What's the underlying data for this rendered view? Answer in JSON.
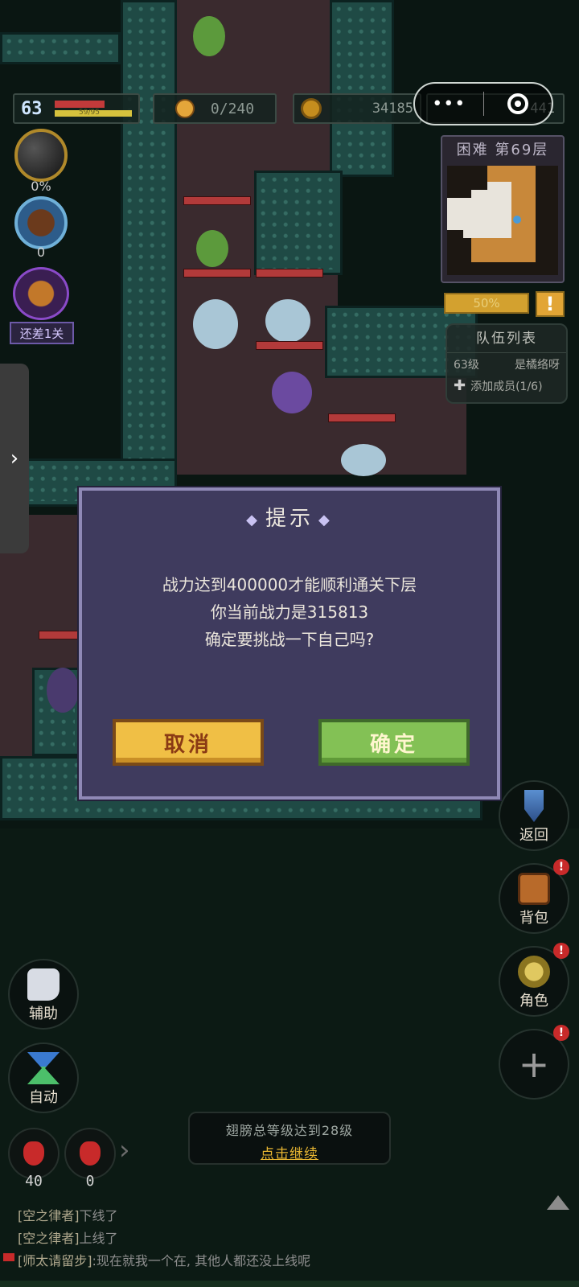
{
  "hud": {
    "level": "63",
    "xp_text": "59/95",
    "counter": "0/240",
    "gold": "34185",
    "gems": "441"
  },
  "left_panel": {
    "orb_percent": "0%",
    "chest_count": "0",
    "stage_badge": "还差1关"
  },
  "minimap": {
    "title": "困难 第69层",
    "progress": "50%"
  },
  "team": {
    "title": "队伍列表",
    "member_level": "63级",
    "member_name": "是橘络呀",
    "add_label": "添加成员(1/6)"
  },
  "dialog": {
    "title": "提示",
    "line1": "战力达到400000才能顺利通关下层",
    "line2": "你当前战力是315813",
    "line3": "确定要挑战一下自己吗?",
    "cancel_label": "取消",
    "ok_label": "确定"
  },
  "right_buttons": [
    {
      "label": "返回"
    },
    {
      "label": "背包"
    },
    {
      "label": "角色"
    },
    {
      "label": ""
    }
  ],
  "left_buttons": {
    "assist_label": "辅助",
    "auto_label": "自动"
  },
  "quest": {
    "text": "翅膀总等级达到28级",
    "action": "点击继续"
  },
  "potions": [
    {
      "count": "40"
    },
    {
      "count": "0"
    }
  ],
  "chat": [
    {
      "tag": "[空之律者]",
      "text": "下线了"
    },
    {
      "tag": "[空之律者]",
      "text": "上线了"
    },
    {
      "tag": "[师太请留步]",
      "text": ":现在就我一个在, 其他人都还没上线呢"
    }
  ],
  "colors": {
    "dialog_bg": "#3f3b5e",
    "cancel_button": "#f0bf45",
    "ok_button": "#83c155",
    "quest_action": "#e7b531",
    "alert": "#c82a2a"
  }
}
